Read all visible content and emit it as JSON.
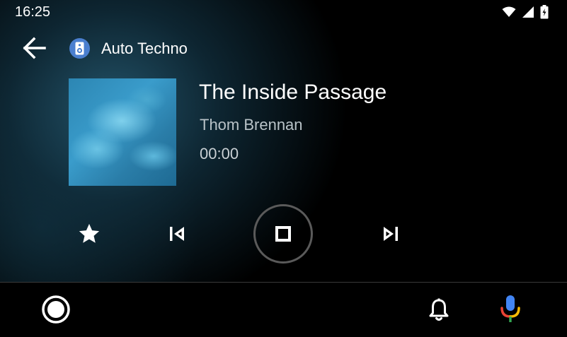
{
  "status_bar": {
    "time": "16:25"
  },
  "header": {
    "back_icon": "arrow-back-icon",
    "app_icon": "speaker-icon",
    "app_name": "Auto Techno"
  },
  "now_playing": {
    "title": "The Inside Passage",
    "artist": "Thom Brennan",
    "elapsed": "00:00"
  },
  "controls": {
    "favorite_icon": "star-icon",
    "previous_icon": "skip-previous-icon",
    "stop_icon": "stop-icon",
    "next_icon": "skip-next-icon"
  },
  "nav_bar": {
    "home_icon": "home-circle-icon",
    "notifications_icon": "bell-icon",
    "voice_icon": "mic-icon"
  },
  "colors": {
    "mic_blue": "#4285F4",
    "mic_red": "#EA4335",
    "mic_yellow": "#FBBC05",
    "mic_green": "#34A853"
  }
}
